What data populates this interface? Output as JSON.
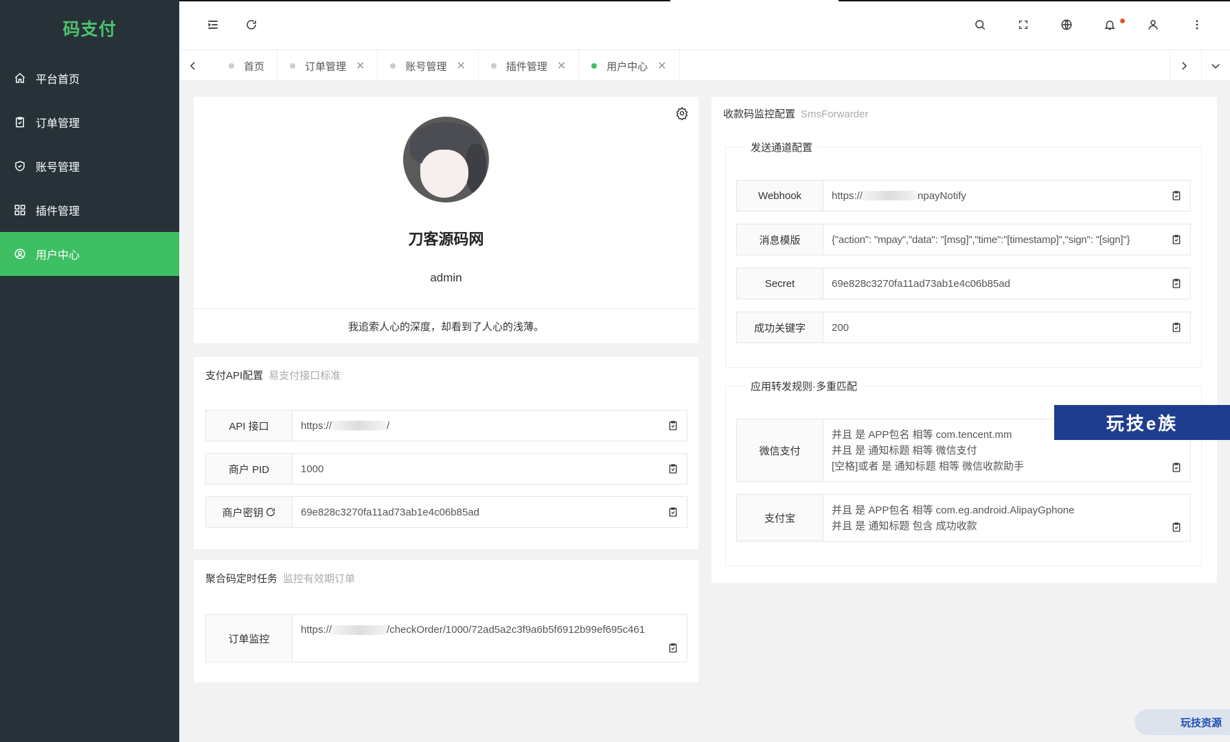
{
  "sidebar": {
    "logo": "码支付",
    "items": [
      {
        "label": "平台首页",
        "icon": "home-icon"
      },
      {
        "label": "订单管理",
        "icon": "clipboard-check-icon"
      },
      {
        "label": "账号管理",
        "icon": "shield-check-icon"
      },
      {
        "label": "插件管理",
        "icon": "grid-icon"
      },
      {
        "label": "用户中心",
        "icon": "user-circle-icon",
        "active": true
      }
    ]
  },
  "header": {
    "icons": [
      "menu-collapse-icon",
      "refresh-icon",
      "search-icon",
      "fullscreen-icon",
      "globe-icon",
      "bell-icon",
      "user-icon",
      "more-vertical-icon"
    ]
  },
  "tabs": [
    {
      "label": "首页",
      "closable": false
    },
    {
      "label": "订单管理",
      "closable": true
    },
    {
      "label": "账号管理",
      "closable": true
    },
    {
      "label": "插件管理",
      "closable": true
    },
    {
      "label": "用户中心",
      "closable": true,
      "active": true
    }
  ],
  "tab_close_glyph": "✕",
  "profile": {
    "name": "刀客源码网",
    "username": "admin",
    "motto": "我追索人心的深度，却看到了人心的浅薄。"
  },
  "pay_api": {
    "title": "支付API配置",
    "subtitle": "易支付接口标准",
    "rows": [
      {
        "label": "API 接口",
        "prefix": "https://",
        "suffix": "/"
      },
      {
        "label": "商户 PID",
        "value": "1000"
      },
      {
        "label": "商户密钥",
        "value": "69e828c3270fa11ad73ab1e4c06b85ad"
      }
    ]
  },
  "cron": {
    "title": "聚合码定时任务",
    "subtitle": "监控有效期订单",
    "row": {
      "label": "订单监控",
      "prefix": "https://",
      "suffix": "/checkOrder/1000/72ad5a2c3f9a6b5f6912b99ef695c461"
    }
  },
  "monitor": {
    "title": "收款码监控配置",
    "subtitle": "SmsForwarder",
    "send_legend": "发送通道配置",
    "send_rows": [
      {
        "label": "Webhook",
        "prefix": "https://",
        "suffix": "npayNotify"
      },
      {
        "label": "消息模版",
        "value": "{\"action\": \"mpay\",\"data\": \"[msg]\",\"time\":\"[timestamp]\",\"sign\": \"[sign]\"}"
      },
      {
        "label": "Secret",
        "value": "69e828c3270fa11ad73ab1e4c06b85ad"
      },
      {
        "label": "成功关键字",
        "value": "200"
      }
    ],
    "rule_legend": "应用转发规则·多重匹配",
    "rule_rows": [
      {
        "label": "微信支付",
        "lines": [
          "并且 是 APP包名 相等 com.tencent.mm",
          "并且 是 通知标题 相等 微信支付",
          "[空格]或者 是 通知标题 相等 微信收款助手"
        ]
      },
      {
        "label": "支付宝",
        "lines": [
          "并且 是 APP包名 相等 com.eg.android.AlipayGphone",
          "并且 是 通知标题 包含 成功收款"
        ]
      }
    ]
  },
  "watermarks": {
    "top": "玩技e族",
    "bottom": "玩技资源"
  },
  "colors": {
    "accent": "#3fbf63",
    "sidebar": "#263238",
    "logo": "#4cc36e"
  }
}
